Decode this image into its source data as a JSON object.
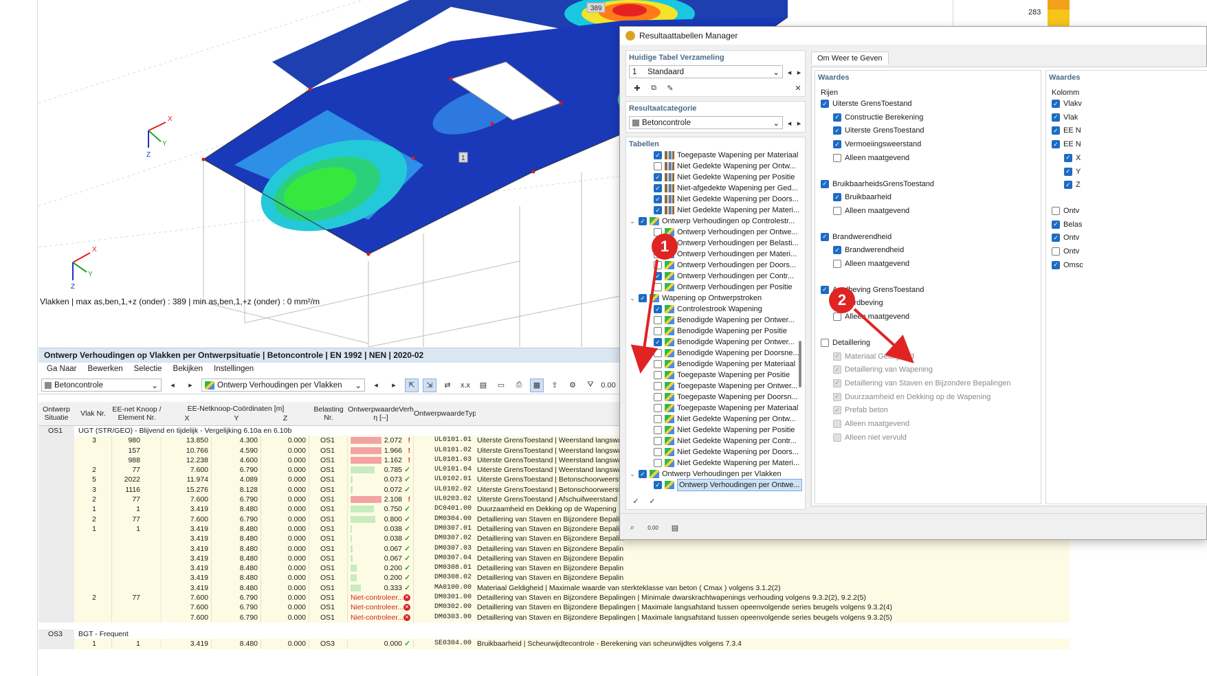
{
  "viewport": {
    "status": "Vlakken | max as,ben,1,+z (onder) : 389 | min as,ben,1,+z (onder) : 0 mm²/m",
    "tag_top": "389",
    "tag_mid": "1",
    "axis_x": "X",
    "axis_y": "Y",
    "axis_z": "Z",
    "right_value": "283"
  },
  "table_panel": {
    "title": "Ontwerp Verhoudingen op Vlakken per Ontwerpsituatie | Betoncontrole | EN 1992 | NEN | 2020-02",
    "menu": [
      "Ga Naar",
      "Bewerken",
      "Selectie",
      "Bekijken",
      "Instellingen"
    ],
    "combo_category": "Betoncontrole",
    "combo_table": "Ontwerp Verhoudingen per Vlakken",
    "headers": {
      "situatie": "Ontwerp\nSituatie",
      "vlak": "Vlak Nr.",
      "knoop": "EE-net Knoop /\nElement Nr.",
      "coords": "EE-Netknoop-Coördinaten [m]",
      "x": "X",
      "y": "Y",
      "z": "Z",
      "belasting": "Belasting\nNr.",
      "ratio": "OntwerpwaardeVerh\nη [--]",
      "type": "OntwerpwaardeTyp"
    },
    "groups": [
      {
        "id": "OS1",
        "label": "UGT (STR/GEO) - Blijvend en tijdelijk - Vergelijking 6.10a en 6.10b",
        "rows": [
          {
            "vlak": "3",
            "knoop": "980",
            "x": "13.850",
            "y": "4.300",
            "z": "0.000",
            "bel": "OS1",
            "ratio": "2.072",
            "ok": false,
            "fill": 1.0,
            "code": "UL0101.01",
            "desc": "Uiterste GrensToestand | Weerstand langswa"
          },
          {
            "vlak": "",
            "knoop": "157",
            "x": "10.766",
            "y": "4.590",
            "z": "0.000",
            "bel": "OS1",
            "ratio": "1.966",
            "ok": false,
            "fill": 1.0,
            "code": "UL0101.02",
            "desc": "Uiterste GrensToestand | Weerstand langswa"
          },
          {
            "vlak": "",
            "knoop": "988",
            "x": "12.238",
            "y": "4.600",
            "z": "0.000",
            "bel": "OS1",
            "ratio": "1.162",
            "ok": false,
            "fill": 1.0,
            "code": "UL0101.03",
            "desc": "Uiterste GrensToestand | Weerstand langswa"
          },
          {
            "vlak": "2",
            "knoop": "77",
            "x": "7.600",
            "y": "6.790",
            "z": "0.000",
            "bel": "OS1",
            "ratio": "0.785",
            "ok": true,
            "fill": 0.785,
            "code": "UL0101.04",
            "desc": "Uiterste GrensToestand | Weerstand langswa"
          },
          {
            "vlak": "5",
            "knoop": "2022",
            "x": "11.974",
            "y": "4.089",
            "z": "0.000",
            "bel": "OS1",
            "ratio": "0.073",
            "ok": true,
            "fill": 0.073,
            "code": "UL0102.01",
            "desc": "Uiterste GrensToestand | Betonschoorweersta"
          },
          {
            "vlak": "3",
            "knoop": "1116",
            "x": "15.276",
            "y": "8.128",
            "z": "0.000",
            "bel": "OS1",
            "ratio": "0.072",
            "ok": true,
            "fill": 0.072,
            "code": "UL0102.02",
            "desc": "Uiterste GrensToestand | Betonschoorweersta"
          },
          {
            "vlak": "2",
            "knoop": "77",
            "x": "7.600",
            "y": "6.790",
            "z": "0.000",
            "bel": "OS1",
            "ratio": "2.108",
            "ok": false,
            "fill": 1.0,
            "code": "UL0203.02",
            "desc": "Uiterste GrensToestand | Afschuifweerstand -"
          },
          {
            "vlak": "1",
            "knoop": "1",
            "x": "3.419",
            "y": "8.480",
            "z": "0.000",
            "bel": "OS1",
            "ratio": "0.750",
            "ok": true,
            "fill": 0.75,
            "code": "DC0401.00",
            "desc": "Duurzaamheid en Dekking op de Wapening"
          },
          {
            "vlak": "2",
            "knoop": "77",
            "x": "7.600",
            "y": "6.790",
            "z": "0.000",
            "bel": "OS1",
            "ratio": "0.800",
            "ok": true,
            "fill": 0.8,
            "code": "DM0304.00",
            "desc": "Detaillering van Staven en Bijzondere Bepalin"
          },
          {
            "vlak": "1",
            "knoop": "1",
            "x": "3.419",
            "y": "8.480",
            "z": "0.000",
            "bel": "OS1",
            "ratio": "0.038",
            "ok": true,
            "fill": 0.038,
            "code": "DM0307.01",
            "desc": "Detaillering van Staven en Bijzondere Bepalin"
          },
          {
            "vlak": "",
            "knoop": "",
            "x": "3.419",
            "y": "8.480",
            "z": "0.000",
            "bel": "OS1",
            "ratio": "0.038",
            "ok": true,
            "fill": 0.038,
            "code": "DM0307.02",
            "desc": "Detaillering van Staven en Bijzondere Bepalin"
          },
          {
            "vlak": "",
            "knoop": "",
            "x": "3.419",
            "y": "8.480",
            "z": "0.000",
            "bel": "OS1",
            "ratio": "0.067",
            "ok": true,
            "fill": 0.067,
            "code": "DM0307.03",
            "desc": "Detaillering van Staven en Bijzondere Bepalin"
          },
          {
            "vlak": "",
            "knoop": "",
            "x": "3.419",
            "y": "8.480",
            "z": "0.000",
            "bel": "OS1",
            "ratio": "0.067",
            "ok": true,
            "fill": 0.067,
            "code": "DM0307.04",
            "desc": "Detaillering van Staven en Bijzondere Bepalin"
          },
          {
            "vlak": "",
            "knoop": "",
            "x": "3.419",
            "y": "8.480",
            "z": "0.000",
            "bel": "OS1",
            "ratio": "0.200",
            "ok": true,
            "fill": 0.2,
            "code": "DM0308.01",
            "desc": "Detaillering van Staven en Bijzondere Bepalin"
          },
          {
            "vlak": "",
            "knoop": "",
            "x": "3.419",
            "y": "8.480",
            "z": "0.000",
            "bel": "OS1",
            "ratio": "0.200",
            "ok": true,
            "fill": 0.2,
            "code": "DM0308.02",
            "desc": "Detaillering van Staven en Bijzondere Bepalin"
          },
          {
            "vlak": "",
            "knoop": "",
            "x": "3.419",
            "y": "8.480",
            "z": "0.000",
            "bel": "OS1",
            "ratio": "0.333",
            "ok": true,
            "fill": 0.333,
            "code": "MA0100.00",
            "desc": "Materiaal Geldigheid | Maximale waarde van sterkteklasse van beton ( Cmax ) volgens 3.1.2(2)"
          },
          {
            "vlak": "2",
            "knoop": "77",
            "x": "7.600",
            "y": "6.790",
            "z": "0.000",
            "bel": "OS1",
            "ratio": "Niet-controleer...",
            "ok": null,
            "fill": 0,
            "code": "DM0301.00",
            "desc": "Detaillering van Staven en Bijzondere Bepalingen | Minimale dwarskrachtwapenings verhouding volgens 9.3.2(2), 9.2.2(5)"
          },
          {
            "vlak": "",
            "knoop": "",
            "x": "7.600",
            "y": "6.790",
            "z": "0.000",
            "bel": "OS1",
            "ratio": "Niet-controleer...",
            "ok": null,
            "fill": 0,
            "code": "DM0302.00",
            "desc": "Detaillering van Staven en Bijzondere Bepalingen | Maximale langsafstand tussen opeenvolgende series beugels volgens 9.3.2(4)"
          },
          {
            "vlak": "",
            "knoop": "",
            "x": "7.600",
            "y": "6.790",
            "z": "0.000",
            "bel": "OS1",
            "ratio": "Niet-controleer...",
            "ok": null,
            "fill": 0,
            "code": "DM0303.00",
            "desc": "Detaillering van Staven en Bijzondere Bepalingen | Maximale langsafstand tussen opeenvolgende series beugels volgens 9.3.2(5)"
          }
        ]
      },
      {
        "id": "OS3",
        "label": "BGT - Frequent",
        "rows": [
          {
            "vlak": "1",
            "knoop": "1",
            "x": "3.419",
            "y": "8.480",
            "z": "0.000",
            "bel": "OS3",
            "ratio": "0.000",
            "ok": true,
            "fill": 0,
            "code": "SE0304.00",
            "desc": "Bruikbaarheid | Scheurwijdtecontrole - Berekening van scheurwijdtes volgens 7.3.4"
          }
        ]
      }
    ]
  },
  "dialog": {
    "title": "Resultaattabellen Manager",
    "collection_title": "Huidige Tabel Verzameling",
    "collection_num": "1",
    "collection_name": "Standaard",
    "category_title": "Resultaatcategorie",
    "category_value": "Betoncontrole",
    "tables_title": "Tabellen",
    "tree": [
      {
        "level": 2,
        "checked": true,
        "icon": "t",
        "label": "Toegepaste Wapening per Materiaal"
      },
      {
        "level": 2,
        "checked": false,
        "icon": "t",
        "label": "Niet Gedekte Wapening per Ontw..."
      },
      {
        "level": 2,
        "checked": true,
        "icon": "t",
        "label": "Niet Gedekte Wapening per Positie"
      },
      {
        "level": 2,
        "checked": true,
        "icon": "t",
        "label": "Niet-afgedekte Wapening per Ged..."
      },
      {
        "level": 2,
        "checked": true,
        "icon": "t",
        "label": "Niet Gedekte Wapening per Doors..."
      },
      {
        "level": 2,
        "checked": true,
        "icon": "t",
        "label": "Niet Gedekte Wapening per Materi..."
      },
      {
        "level": 1,
        "checked": true,
        "icon": "g",
        "label": "Ontwerp Verhoudingen op Controlestr..."
      },
      {
        "level": 2,
        "checked": false,
        "icon": "g",
        "label": "Ontwerp Verhoudingen per Ontwe..."
      },
      {
        "level": 2,
        "checked": false,
        "icon": "g",
        "label": "Ontwerp Verhoudingen per Belasti..."
      },
      {
        "level": 2,
        "checked": false,
        "icon": "g",
        "label": "Ontwerp Verhoudingen per Materi..."
      },
      {
        "level": 2,
        "checked": false,
        "icon": "g",
        "label": "Ontwerp Verhoudingen per Doors..."
      },
      {
        "level": 2,
        "checked": true,
        "icon": "g",
        "label": "Ontwerp Verhoudingen per Contr..."
      },
      {
        "level": 2,
        "checked": false,
        "icon": "g",
        "label": "Ontwerp Verhoudingen per Positie"
      },
      {
        "level": 1,
        "checked": true,
        "icon": "g",
        "label": "Wapening op Ontwerpstroken"
      },
      {
        "level": 2,
        "checked": true,
        "icon": "g",
        "label": "Controlestrook Wapening"
      },
      {
        "level": 2,
        "checked": false,
        "icon": "g",
        "label": "Benodigde Wapening per Ontwer..."
      },
      {
        "level": 2,
        "checked": false,
        "icon": "g",
        "label": "Benodigde Wapening per Positie"
      },
      {
        "level": 2,
        "checked": true,
        "icon": "g",
        "label": "Benodigde Wapening per Ontwer..."
      },
      {
        "level": 2,
        "checked": false,
        "icon": "g",
        "label": "Benodigde Wapening per Doorsne..."
      },
      {
        "level": 2,
        "checked": false,
        "icon": "g",
        "label": "Benodigde Wapening per Materiaal"
      },
      {
        "level": 2,
        "checked": false,
        "icon": "g",
        "label": "Toegepaste Wapening per Positie"
      },
      {
        "level": 2,
        "checked": false,
        "icon": "g",
        "label": "Toegepaste Wapening per Ontwer..."
      },
      {
        "level": 2,
        "checked": false,
        "icon": "g",
        "label": "Toegepaste Wapening per Doorsn..."
      },
      {
        "level": 2,
        "checked": false,
        "icon": "g",
        "label": "Toegepaste Wapening per Materiaal"
      },
      {
        "level": 2,
        "checked": false,
        "icon": "g",
        "label": "Niet Gedekte Wapening per Ontw..."
      },
      {
        "level": 2,
        "checked": false,
        "icon": "g",
        "label": "Niet Gedekte Wapening per Positie"
      },
      {
        "level": 2,
        "checked": false,
        "icon": "g",
        "label": "Niet Gedekte Wapening per Contr..."
      },
      {
        "level": 2,
        "checked": false,
        "icon": "g",
        "label": "Niet Gedekte Wapening per Doors..."
      },
      {
        "level": 2,
        "checked": false,
        "icon": "g",
        "label": "Niet Gedekte Wapening per Materi..."
      },
      {
        "level": 1,
        "checked": true,
        "icon": "g",
        "label": "Ontwerp Verhoudingen per Vlakken"
      },
      {
        "level": 2,
        "checked": true,
        "icon": "g",
        "label": "Ontwerp Verhoudingen per Ontwe...",
        "selected": true
      }
    ],
    "tab_label": "Om Weer te Geven",
    "waardes_title": "Waardes",
    "rijen_title": "Rijen",
    "rijen": [
      {
        "indent": 0,
        "checked": true,
        "label": "Uiterste GrensToestand",
        "gap": false
      },
      {
        "indent": 1,
        "checked": true,
        "label": "Constructie Berekening"
      },
      {
        "indent": 1,
        "checked": true,
        "label": "Uiterste GrensToestand"
      },
      {
        "indent": 1,
        "checked": true,
        "label": "Vermoeiingsweerstand"
      },
      {
        "indent": 1,
        "checked": false,
        "label": "Alleen maatgevend"
      },
      {
        "indent": 0,
        "checked": true,
        "label": "BruikbaarheidsGrensToestand",
        "gap": true
      },
      {
        "indent": 1,
        "checked": true,
        "label": "Bruikbaarheid"
      },
      {
        "indent": 1,
        "checked": false,
        "label": "Alleen maatgevend"
      },
      {
        "indent": 0,
        "checked": true,
        "label": "Brandwerendheid",
        "gap": true
      },
      {
        "indent": 1,
        "checked": true,
        "label": "Brandwerendheid"
      },
      {
        "indent": 1,
        "checked": false,
        "label": "Alleen maatgevend"
      },
      {
        "indent": 0,
        "checked": true,
        "label": "Aardbeving GrensToestand",
        "gap": true
      },
      {
        "indent": 1,
        "checked": true,
        "label": "Aardbeving"
      },
      {
        "indent": 1,
        "checked": false,
        "label": "Alleen maatgevend"
      },
      {
        "indent": 0,
        "checked": false,
        "label": "Detaillering",
        "gap": true
      },
      {
        "indent": 1,
        "checked": true,
        "disabled": true,
        "label": "Materiaal Geldigheid"
      },
      {
        "indent": 1,
        "checked": true,
        "disabled": true,
        "label": "Detaillering van Wapening"
      },
      {
        "indent": 1,
        "checked": true,
        "disabled": true,
        "label": "Detaillering van Staven en Bijzondere Bepalingen"
      },
      {
        "indent": 1,
        "checked": true,
        "disabled": true,
        "label": "Duurzaamheid en Dekking op de Wapening"
      },
      {
        "indent": 1,
        "checked": true,
        "disabled": true,
        "label": "Prefab beton"
      },
      {
        "indent": 1,
        "checked": false,
        "disabled": true,
        "label": "Alleen maatgevend"
      },
      {
        "indent": 1,
        "checked": false,
        "disabled": true,
        "label": "Alleen niet vervuld"
      }
    ],
    "waardes2_title": "Waardes",
    "kolom_title": "Kolomm",
    "kolom": [
      {
        "indent": 0,
        "checked": true,
        "label": "Vlakv"
      },
      {
        "indent": 0,
        "checked": true,
        "label": "Vlak"
      },
      {
        "indent": 0,
        "checked": true,
        "label": "EE N"
      },
      {
        "indent": 0,
        "checked": true,
        "label": "EE N"
      },
      {
        "indent": 1,
        "checked": true,
        "label": "X"
      },
      {
        "indent": 1,
        "checked": true,
        "label": "Y"
      },
      {
        "indent": 1,
        "checked": true,
        "label": "Z"
      },
      {
        "indent": 0,
        "checked": false,
        "label": "Ontv",
        "gap": true
      },
      {
        "indent": 0,
        "checked": true,
        "label": "Belas"
      },
      {
        "indent": 0,
        "checked": true,
        "label": "Ontv"
      },
      {
        "indent": 0,
        "checked": false,
        "label": "Ontv"
      },
      {
        "indent": 0,
        "checked": true,
        "label": "Omsc"
      }
    ]
  },
  "annotations": {
    "one": "1",
    "two": "2"
  }
}
